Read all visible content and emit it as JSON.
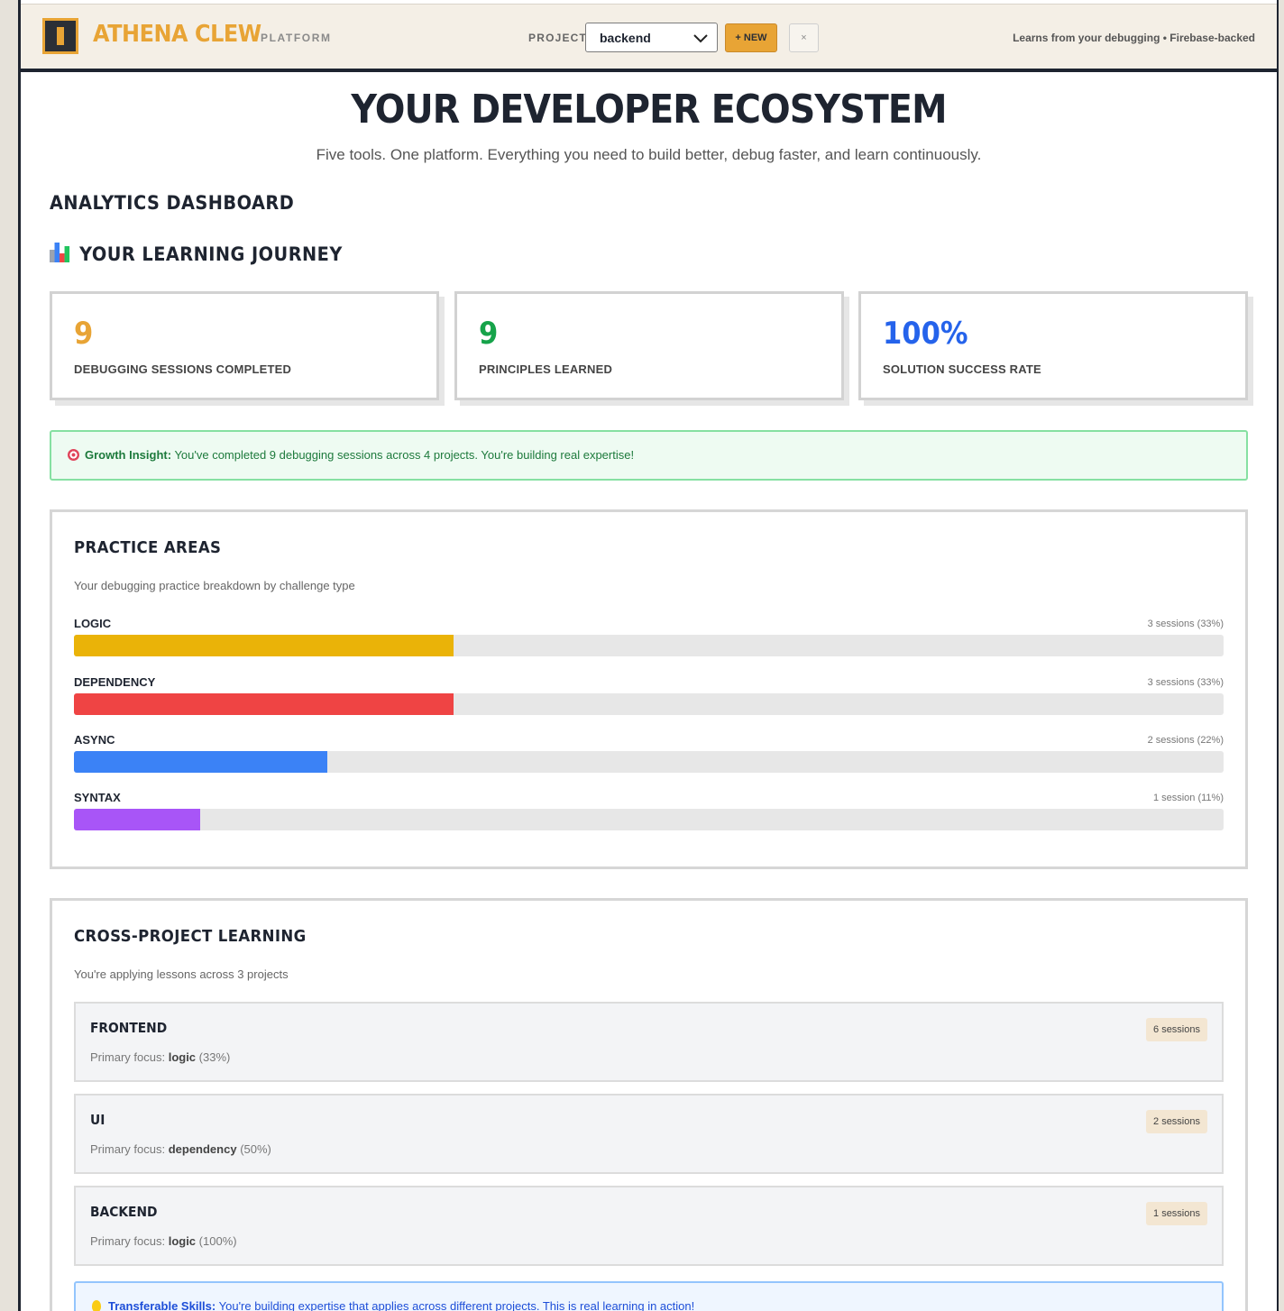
{
  "header": {
    "brand": "ATHENA CLEW",
    "brand_sub": "PLATFORM",
    "project_label": "PROJECT:",
    "project_value": "backend",
    "new_label": "+ NEW",
    "close_label": "×",
    "tagline": "Learns from your debugging • Firebase-backed"
  },
  "hero": {
    "title": "YOUR DEVELOPER ECOSYSTEM",
    "subtitle": "Five tools. One platform. Everything you need to build better, debug faster, and learn continuously."
  },
  "dashboard": {
    "title": "ANALYTICS DASHBOARD",
    "journey_title": "YOUR LEARNING JOURNEY",
    "stats": [
      {
        "value": "9",
        "label": "DEBUGGING SESSIONS COMPLETED",
        "color": "#e8a435"
      },
      {
        "value": "9",
        "label": "PRINCIPLES LEARNED",
        "color": "#16a34a"
      },
      {
        "value": "100%",
        "label": "SOLUTION SUCCESS RATE",
        "color": "#2563eb"
      }
    ],
    "insight": {
      "label": "Growth Insight:",
      "text": "You've completed 9 debugging sessions across 4 projects. You're building real expertise!"
    }
  },
  "practice": {
    "title": "PRACTICE AREAS",
    "description": "Your debugging practice breakdown by challenge type",
    "areas": [
      {
        "name": "LOGIC",
        "meta": "3 sessions (33%)",
        "fraction": 0.33,
        "color": "#eab308"
      },
      {
        "name": "DEPENDENCY",
        "meta": "3 sessions (33%)",
        "fraction": 0.33,
        "color": "#ef4444"
      },
      {
        "name": "ASYNC",
        "meta": "2 sessions (22%)",
        "fraction": 0.22,
        "color": "#3b82f6"
      },
      {
        "name": "SYNTAX",
        "meta": "1 session (11%)",
        "fraction": 0.11,
        "color": "#a855f7"
      }
    ]
  },
  "cross": {
    "title": "CROSS-PROJECT LEARNING",
    "description": "You're applying lessons across 3 projects",
    "focus_prefix": "Primary focus:",
    "projects": [
      {
        "name": "FRONTEND",
        "focus": "logic",
        "pct": "(33%)",
        "badge": "6 sessions"
      },
      {
        "name": "UI",
        "focus": "dependency",
        "pct": "(50%)",
        "badge": "2 sessions"
      },
      {
        "name": "BACKEND",
        "focus": "logic",
        "pct": "(100%)",
        "badge": "1 sessions"
      }
    ],
    "transfer": {
      "label": "Transferable Skills:",
      "text": "You're building expertise that applies across different projects. This is real learning in action!"
    }
  }
}
